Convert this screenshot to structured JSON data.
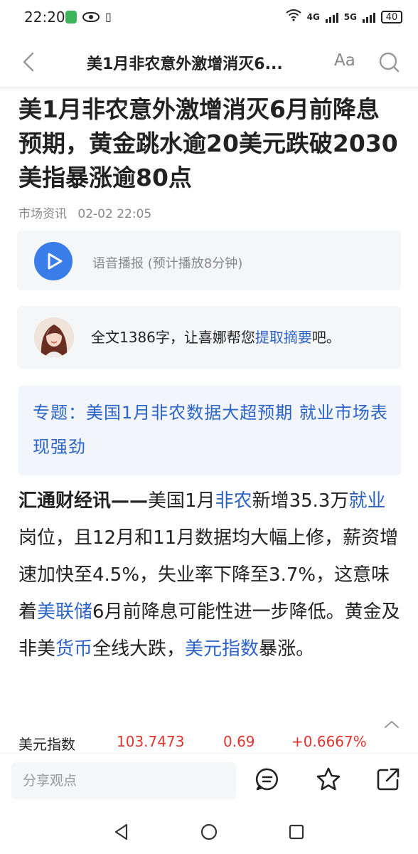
{
  "status_bar": {
    "time": "22:20",
    "net1": "4G",
    "net2": "5G",
    "battery": "40"
  },
  "header": {
    "title": "美1月非农意外激增消灭6...",
    "font_button": "Aa"
  },
  "article": {
    "title": "美1月非农意外激增消灭6月前降息预期，黄金跳水逾20美元跌破2030 美指暴涨逾80点",
    "source": "市场资讯",
    "datetime": "02-02 22:05"
  },
  "audio": {
    "label": "语音播报 (预计播放8分钟)"
  },
  "summary": {
    "prefix": "全文1386字，让喜娜帮您",
    "link": "提取摘要",
    "suffix": "吧。"
  },
  "topic": {
    "text": "专题：美国1月非农数据大超预期 就业市场表现强劲"
  },
  "body": {
    "lead": "汇通财经讯——",
    "p1": "美国1月",
    "k1": "非农",
    "p2": "新增35.3万",
    "k2": "就业",
    "p3": "岗位，且12月和11月数据均大幅上修，薪资增速加快至4.5%，失业率下降至3.7%，这意味着",
    "k3": "美联储",
    "p4": "6月前降息可能性进一步降低。黄金及非美",
    "k4": "货币",
    "p5": "全线大跌，",
    "k5": "美元指数",
    "p6": "暴涨。"
  },
  "quote": {
    "name": "美元指数",
    "price": "103.7473",
    "change": "0.69",
    "percent": "+0.6667%",
    "color": "#e0352f"
  },
  "toolbar": {
    "comment_placeholder": "分享观点"
  },
  "icons": {
    "back": "back-chevron-icon",
    "search": "search-icon",
    "play": "play-icon",
    "comment": "comment-icon",
    "favorite": "star-icon",
    "share": "share-icon"
  },
  "colors": {
    "accent": "#3b7de8",
    "link": "#2c63c6",
    "up": "#e0352f"
  }
}
